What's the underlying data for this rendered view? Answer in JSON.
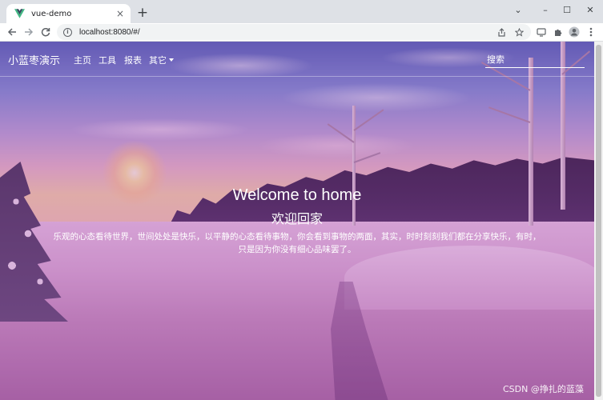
{
  "browser": {
    "tab_title": "vue-demo",
    "tab_close": "×",
    "new_tab": "+",
    "url": "localhost:8080/#/",
    "window_controls": [
      "⌄",
      "–",
      "☐",
      "✕"
    ],
    "icons": [
      "vue-logo-icon",
      "back-icon",
      "forward-icon",
      "reload-icon",
      "info-icon",
      "share-icon",
      "bookmark-star-icon",
      "extension-icon",
      "puzzle-icon",
      "profile-icon",
      "menu-icon"
    ]
  },
  "navbar": {
    "brand": "小蓝枣演示",
    "links": [
      "主页",
      "工具",
      "报表"
    ],
    "dropdown_label": "其它",
    "search_placeholder": "搜索"
  },
  "hero": {
    "title": "Welcome to home",
    "subtitle": "欢迎回家",
    "body_line1": "乐观的心态看待世界，世间处处是快乐，以平静的心态看待事物，你会看到事物的两面，其实，时时刻刻我们都在分享快乐，有时，",
    "body_line2": "只是因为你没有细心品味罢了。"
  },
  "watermark": "CSDN @挣扎的蓝藻",
  "colors": {
    "overlay": "#a046aa",
    "text": "#ffffff",
    "chrome_bg": "#dee1e6",
    "vue_green": "#41b883",
    "vue_dark": "#35495e"
  }
}
